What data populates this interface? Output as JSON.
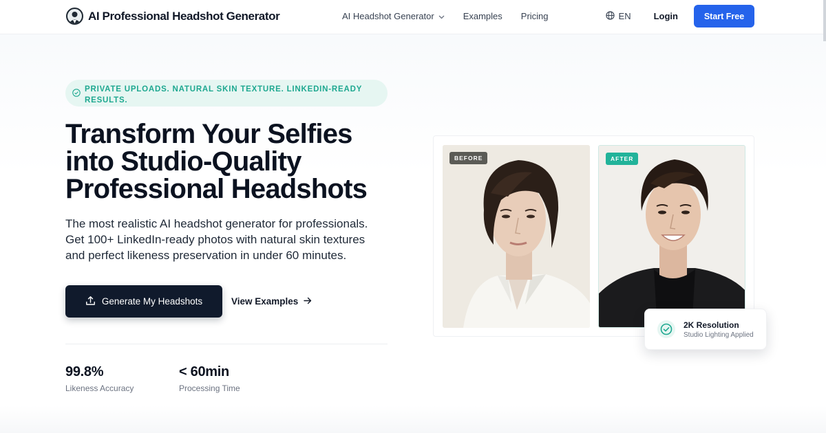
{
  "nav": {
    "brand": "AI Professional Headshot Generator",
    "links": [
      {
        "label": "AI Headshot Generator",
        "has_dropdown": true
      },
      {
        "label": "Examples",
        "has_dropdown": false
      },
      {
        "label": "Pricing",
        "has_dropdown": false
      }
    ],
    "language": "EN",
    "login": "Login",
    "cta": "Start Free"
  },
  "hero": {
    "badge_lines": [
      "PRIVATE UPLOADS. NATURAL SKIN TEXTURE. LINKEDIN-READY",
      "RESULTS."
    ],
    "title_lines": [
      "Transform Your Selfies",
      "into Studio-Quality",
      "Professional Headshots"
    ],
    "subtitle_lines": [
      "The most realistic AI headshot generator for professionals.",
      "Get 100+ LinkedIn-ready photos with natural skin textures",
      "and perfect likeness preservation in under 60 minutes."
    ],
    "primary_cta": "Generate My Headshots",
    "secondary_cta": "View Examples",
    "stats": [
      {
        "value": "99.8%",
        "label": "Likeness Accuracy"
      },
      {
        "value": "< 60min",
        "label": "Processing Time"
      }
    ]
  },
  "comparison": {
    "before_tag": "BEFORE",
    "after_tag": "AFTER",
    "feature_title": "2K Resolution",
    "feature_subtitle": "Studio Lighting Applied"
  },
  "colors": {
    "primary_blue": "#2563eb",
    "accent_teal": "#22b39a",
    "dark_button": "#101a2c",
    "badge_bg": "#e6f6f2"
  },
  "icons": {
    "brand": "headshot-logo-icon",
    "language": "globe-icon",
    "badge": "check-circle-icon",
    "primary_cta": "upload-icon",
    "secondary_cta": "arrow-right-icon",
    "feature": "check-circle-icon"
  }
}
